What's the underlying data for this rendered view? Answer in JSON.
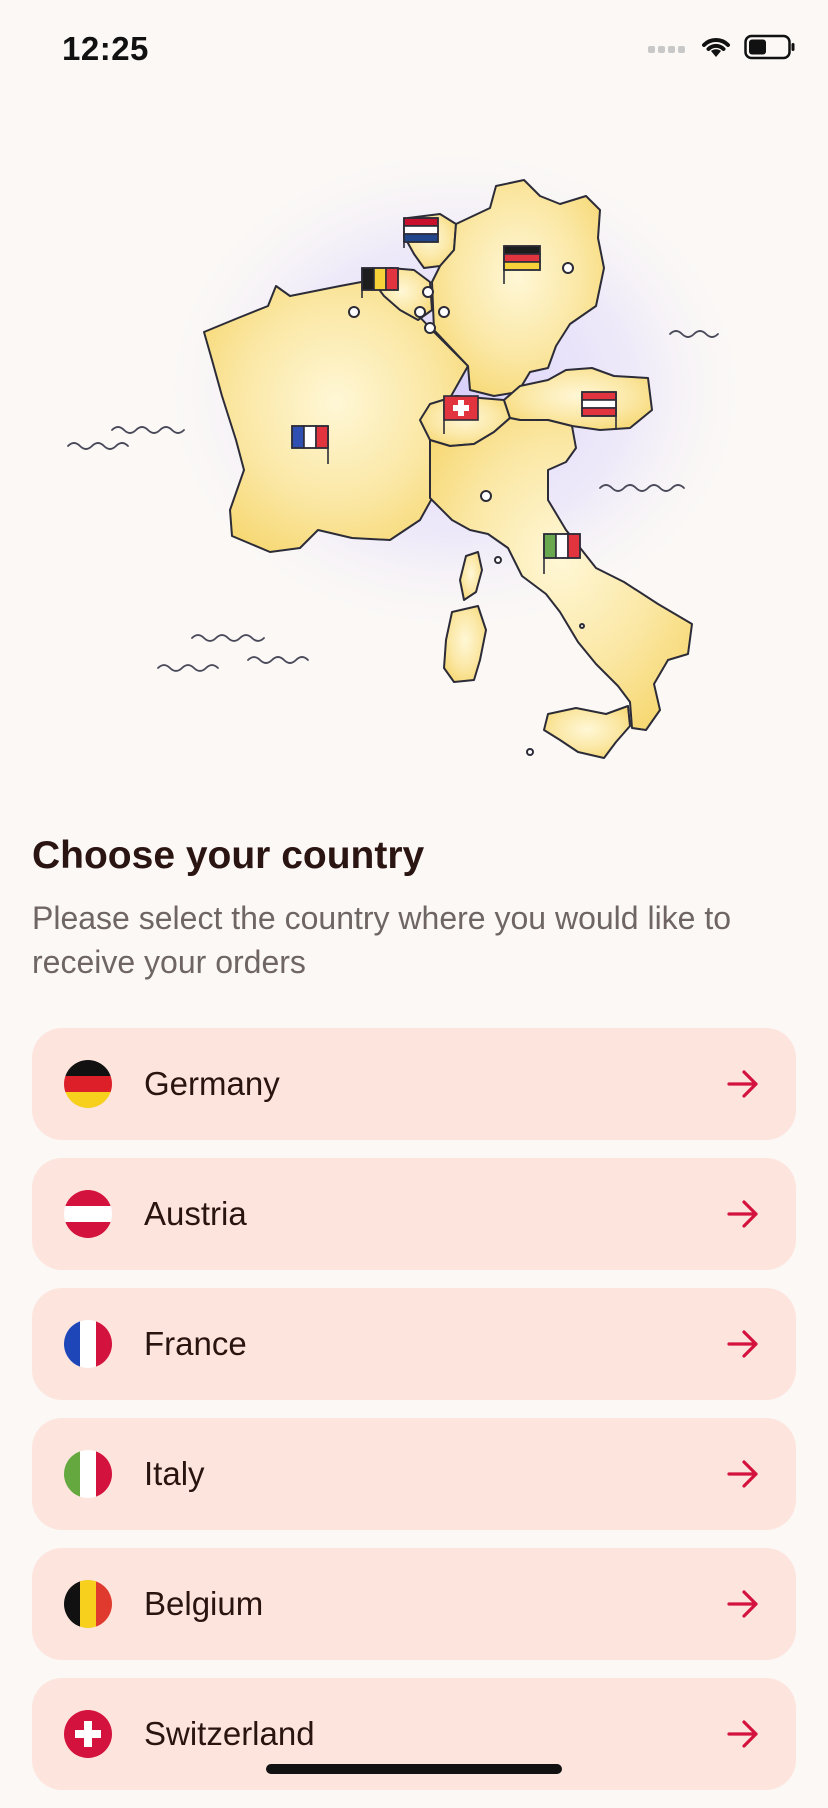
{
  "status_bar": {
    "time": "12:25",
    "icons": [
      "signal-icon",
      "wifi-icon",
      "battery-icon"
    ]
  },
  "illustration": {
    "icon": "europe-map-illustration",
    "flags": [
      "netherlands-flag",
      "belgium-flag",
      "germany-flag",
      "france-flag",
      "switzerland-flag",
      "austria-flag",
      "italy-flag"
    ]
  },
  "header": {
    "title": "Choose your country",
    "subtitle": "Please select the country where you would like to receive your orders"
  },
  "countries": [
    {
      "name": "Germany",
      "flag": "germany-flag-icon"
    },
    {
      "name": "Austria",
      "flag": "austria-flag-icon"
    },
    {
      "name": "France",
      "flag": "france-flag-icon"
    },
    {
      "name": "Italy",
      "flag": "italy-flag-icon"
    },
    {
      "name": "Belgium",
      "flag": "belgium-flag-icon"
    },
    {
      "name": "Switzerland",
      "flag": "switzerland-flag-icon"
    }
  ],
  "colors": {
    "background": "#fbf8f6",
    "card": "#fde5de",
    "accent": "#d3123d",
    "title": "#2b1512",
    "subtitle": "#6f6663",
    "map_fill": "#fbe49a",
    "map_glow": "#ddd6fa"
  }
}
